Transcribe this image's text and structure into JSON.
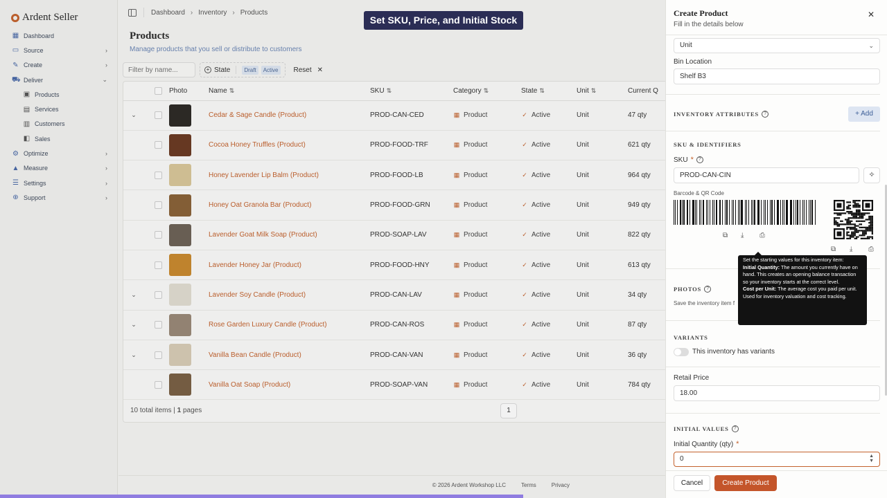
{
  "caption": "Set SKU, Price, and Initial Stock",
  "sidebar": {
    "brand": "Ardent Seller",
    "items": [
      {
        "label": "Dashboard",
        "icon": "dashboard-icon",
        "chevron": ""
      },
      {
        "label": "Source",
        "icon": "source-icon",
        "chevron": "›"
      },
      {
        "label": "Create",
        "icon": "create-icon",
        "chevron": "›"
      },
      {
        "label": "Deliver",
        "icon": "deliver-icon",
        "chevron": "⌄"
      },
      {
        "label": "Products",
        "icon": "products-icon",
        "chevron": "",
        "sub": true
      },
      {
        "label": "Services",
        "icon": "services-icon",
        "chevron": "",
        "sub": true
      },
      {
        "label": "Customers",
        "icon": "customers-icon",
        "chevron": "",
        "sub": true
      },
      {
        "label": "Sales",
        "icon": "sales-icon",
        "chevron": "",
        "sub": true
      },
      {
        "label": "Optimize",
        "icon": "optimize-icon",
        "chevron": "›"
      },
      {
        "label": "Measure",
        "icon": "measure-icon",
        "chevron": "›"
      },
      {
        "label": "Settings",
        "icon": "settings-icon",
        "chevron": "›"
      },
      {
        "label": "Support",
        "icon": "support-icon",
        "chevron": "›"
      }
    ]
  },
  "breadcrumb": [
    "Dashboard",
    "Inventory",
    "Products"
  ],
  "page": {
    "title": "Products",
    "subtitle": "Manage products that you sell or distribute to customers"
  },
  "filters": {
    "placeholder": "Filter by name...",
    "state_label": "State",
    "chips": [
      "Draft",
      "Active"
    ],
    "reset_label": "Reset"
  },
  "table": {
    "columns": [
      "Photo",
      "Name",
      "SKU",
      "Category",
      "State",
      "Unit",
      "Current Q"
    ],
    "rows": [
      {
        "name": "Cedar & Sage Candle (Product)",
        "sku": "PROD-CAN-CED",
        "category": "Product",
        "state": "Active",
        "unit": "Unit",
        "qty": "47 qty",
        "expand": true,
        "thumb": "#2d2a26"
      },
      {
        "name": "Cocoa Honey Truffles (Product)",
        "sku": "PROD-FOOD-TRF",
        "category": "Product",
        "state": "Active",
        "unit": "Unit",
        "qty": "621 qty",
        "expand": false,
        "thumb": "#6b3a22"
      },
      {
        "name": "Honey Lavender Lip Balm (Product)",
        "sku": "PROD-FOOD-LB",
        "category": "Product",
        "state": "Active",
        "unit": "Unit",
        "qty": "964 qty",
        "expand": false,
        "thumb": "#d9c79a"
      },
      {
        "name": "Honey Oat Granola Bar (Product)",
        "sku": "PROD-FOOD-GRN",
        "category": "Product",
        "state": "Active",
        "unit": "Unit",
        "qty": "949 qty",
        "expand": false,
        "thumb": "#8a6238"
      },
      {
        "name": "Lavender Goat Milk Soap (Product)",
        "sku": "PROD-SOAP-LAV",
        "category": "Product",
        "state": "Active",
        "unit": "Unit",
        "qty": "822 qty",
        "expand": false,
        "thumb": "#6d6257"
      },
      {
        "name": "Lavender Honey Jar (Product)",
        "sku": "PROD-FOOD-HNY",
        "category": "Product",
        "state": "Active",
        "unit": "Unit",
        "qty": "613 qty",
        "expand": false,
        "thumb": "#c98a2e"
      },
      {
        "name": "Lavender Soy Candle (Product)",
        "sku": "PROD-CAN-LAV",
        "category": "Product",
        "state": "Active",
        "unit": "Unit",
        "qty": "34 qty",
        "expand": true,
        "thumb": "#e2ddd2"
      },
      {
        "name": "Rose Garden Luxury Candle (Product)",
        "sku": "PROD-CAN-ROS",
        "category": "Product",
        "state": "Active",
        "unit": "Unit",
        "qty": "87 qty",
        "expand": true,
        "thumb": "#9a8877"
      },
      {
        "name": "Vanilla Bean Candle (Product)",
        "sku": "PROD-CAN-VAN",
        "category": "Product",
        "state": "Active",
        "unit": "Unit",
        "qty": "36 qty",
        "expand": true,
        "thumb": "#d8cdb6"
      },
      {
        "name": "Vanilla Oat Soap (Product)",
        "sku": "PROD-SOAP-VAN",
        "category": "Product",
        "state": "Active",
        "unit": "Unit",
        "qty": "784 qty",
        "expand": false,
        "thumb": "#7a6044"
      }
    ],
    "total_count": "10",
    "total_label": "total items",
    "page_count": "1",
    "pages_label": "pages",
    "current_page": "1"
  },
  "footer": {
    "copyright": "© 2026 Ardent Workshop LLC",
    "terms": "Terms",
    "privacy": "Privacy"
  },
  "drawer": {
    "title": "Create Product",
    "subtitle": "Fill in the details below",
    "unit_value": "Unit",
    "bin_label": "Bin Location",
    "bin_value": "Shelf B3",
    "inv_attr_title": "Inventory Attributes",
    "add_label": "Add",
    "sku_section": "SKU & Identifiers",
    "sku_label": "SKU",
    "sku_value": "PROD-CAN-CIN",
    "barcode_label": "Barcode & QR Code",
    "photos_title": "Photos",
    "photos_hint": "Save the inventory item f",
    "variants_title": "Variants",
    "variants_toggle": "This inventory has variants",
    "retail_label": "Retail Price",
    "retail_value": "18.00",
    "initial_title": "Initial Values",
    "initial_qty_label": "Initial Quantity (qty)",
    "initial_qty_value": "0",
    "cancel_label": "Cancel",
    "create_label": "Create Product"
  },
  "tooltip": {
    "intro": "Set the starting values for this inventory item:",
    "qty_term": "Initial Quantity:",
    "qty_desc": "The amount you currently have on hand. This creates an opening balance transaction so your inventory starts at the correct level.",
    "cost_term": "Cost per Unit:",
    "cost_desc": "The average cost you paid per unit. Used for inventory valuation and cost tracking."
  },
  "colors": {
    "accent": "#c4622d",
    "link_blue": "#6b86b5",
    "caption_bg": "#2b2d55",
    "progress": "#8f7ce0"
  }
}
